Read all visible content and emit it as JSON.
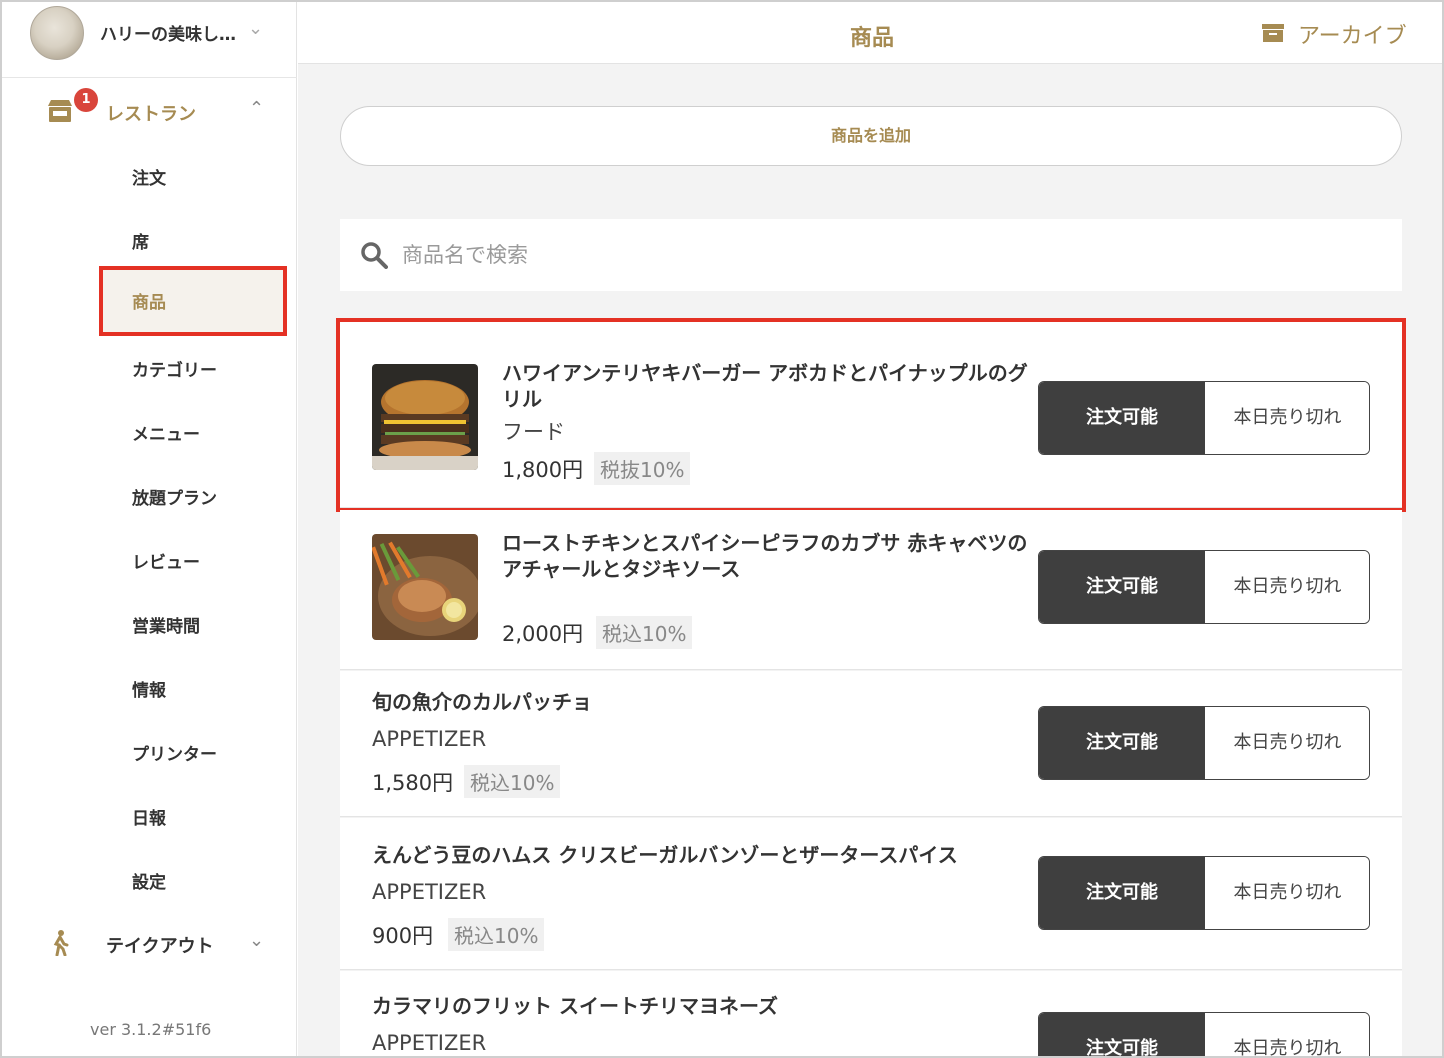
{
  "sidebar": {
    "account_name": "ハリーの美味し…",
    "groups": [
      {
        "label": "レストラン",
        "badge": "1"
      },
      {
        "label": "テイクアウト"
      }
    ],
    "items": [
      "注文",
      "席",
      "商品",
      "カテゴリー",
      "メニュー",
      "放題プラン",
      "レビュー",
      "営業時間",
      "情報",
      "プリンター",
      "日報",
      "設定"
    ],
    "version": "ver 3.1.2#51f6"
  },
  "header": {
    "title": "商品",
    "archive_label": "アーカイブ"
  },
  "main": {
    "add_label": "商品を追加",
    "search_placeholder": "商品名で検索",
    "products": [
      {
        "name": "ハワイアンテリヤキバーガー アボカドとパイナップルのグリル",
        "category": "フード",
        "price": "1,800円",
        "tax": "税抜10%",
        "available": "注文可能",
        "soldout": "本日売り切れ"
      },
      {
        "name": "ローストチキンとスパイシーピラフのカブサ 赤キャベツのアチャールとタジキソース",
        "category": "",
        "price": "2,000円",
        "tax": "税込10%",
        "available": "注文可能",
        "soldout": "本日売り切れ"
      },
      {
        "name": "旬の魚介のカルパッチョ",
        "category": "APPETIZER",
        "price": "1,580円",
        "tax": "税込10%",
        "available": "注文可能",
        "soldout": "本日売り切れ"
      },
      {
        "name": "えんどう豆のハムス クリスビーガルバンゾーとザータースパイス",
        "category": "APPETIZER",
        "price": "900円",
        "tax": "税込10%",
        "available": "注文可能",
        "soldout": "本日売り切れ"
      },
      {
        "name": "カラマリのフリット スイートチリマヨネーズ",
        "category": "APPETIZER",
        "price": "",
        "tax": "",
        "available": "注文可能",
        "soldout": "本日売り切れ"
      }
    ]
  },
  "colors": {
    "accent": "#a68b52",
    "highlight": "#e43124",
    "toggle_on": "#3f3f3f"
  }
}
